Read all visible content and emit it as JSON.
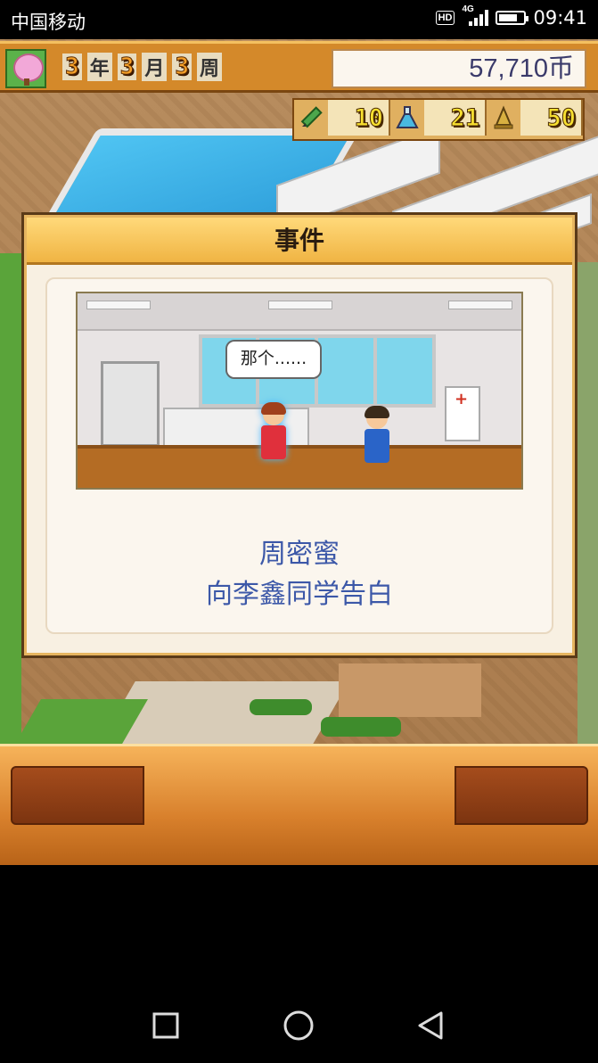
{
  "status_bar": {
    "carrier": "中国移动",
    "hd_label": "HD",
    "network": "4G",
    "time": "09:41",
    "battery_level": 0.75
  },
  "hud": {
    "year": "3",
    "year_unit": "年",
    "month": "3",
    "month_unit": "月",
    "week": "3",
    "week_unit": "周",
    "money": "57,710币",
    "stats": [
      {
        "icon": "pencil-icon",
        "value": "10"
      },
      {
        "icon": "flask-icon",
        "value": "21"
      },
      {
        "icon": "bell-icon",
        "value": "50"
      }
    ]
  },
  "event_dialog": {
    "title": "事件",
    "speech": "那个......",
    "student_name": "周密蜜",
    "description": "向李鑫同学告白"
  },
  "colors": {
    "hud_orange": "#d4892a",
    "dialog_header": "#f0b443",
    "event_text": "#3c58a8",
    "panel": "#d8802c"
  },
  "nav": {
    "icons": [
      "recent-apps-icon",
      "home-icon",
      "back-icon"
    ]
  }
}
